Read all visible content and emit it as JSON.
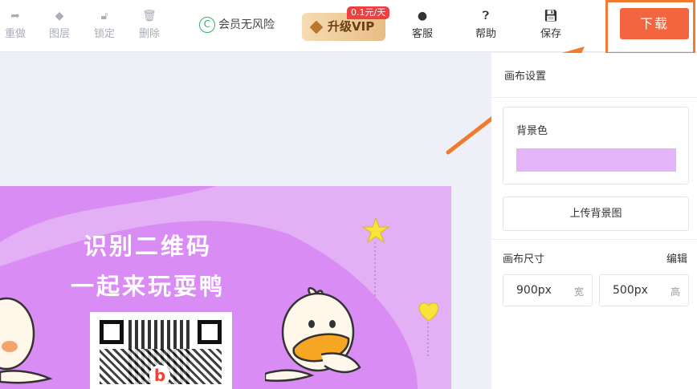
{
  "toolbar": {
    "items": [
      {
        "label": "重做",
        "icon": "redo-icon"
      },
      {
        "label": "图层",
        "icon": "layers-icon"
      },
      {
        "label": "锁定",
        "icon": "lock-icon"
      },
      {
        "label": "删除",
        "icon": "trash-icon"
      }
    ],
    "risk_label": "会员无风险",
    "vip_label": "升级VIP",
    "vip_badge": "0.1元/天",
    "service_label": "客服",
    "help_label": "帮助",
    "save_label": "保存",
    "download_label": "下载"
  },
  "artwork": {
    "line1": "识别二维码",
    "line2": "一起来玩耍鸭"
  },
  "panel": {
    "title": "画布设置",
    "bg_color_label": "背景色",
    "bg_color": "#e3b4f8",
    "upload_label": "上传背景图",
    "size_label": "画布尺寸",
    "edit_label": "编辑",
    "width_value": "900px",
    "width_unit": "宽",
    "height_value": "500px",
    "height_unit": "高"
  },
  "colors": {
    "accent": "#f2653f",
    "highlight": "#f07a2d",
    "canvas_purple": "#d98cf4"
  }
}
